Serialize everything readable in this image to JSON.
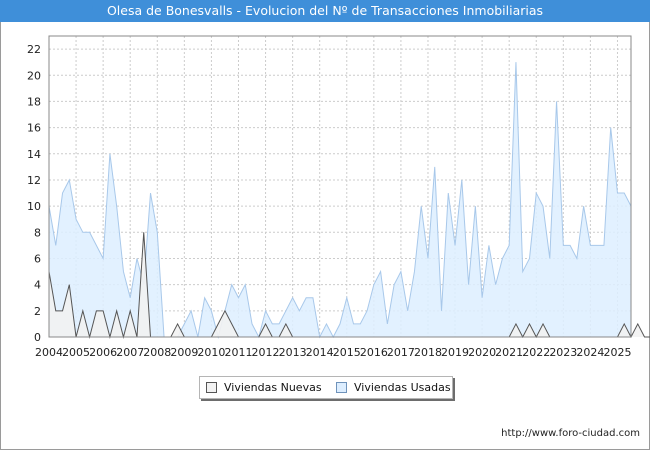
{
  "title": "Olesa de Bonesvalls - Evolucion del Nº de Transacciones Inmobiliarias",
  "footer_url": "http://www.foro-ciudad.com",
  "colors": {
    "title_bg": "#3f8fd9",
    "nuevas_fill": "#f2f2f2",
    "nuevas_line": "#555555",
    "usadas_fill": "#ddeeff",
    "usadas_line": "#a8c8ea",
    "grid": "#cccccc"
  },
  "chart_data": {
    "type": "area",
    "title": "Olesa de Bonesvalls - Evolucion del Nº de Transacciones Inmobiliarias",
    "xlabel": "",
    "ylabel": "",
    "x_ticks": [
      "2004",
      "2005",
      "2006",
      "2007",
      "2008",
      "2009",
      "2010",
      "2011",
      "2012",
      "2013",
      "2014",
      "2015",
      "2016",
      "2017",
      "2018",
      "2019",
      "2020",
      "2021",
      "2022",
      "2023",
      "2024",
      "2025"
    ],
    "x_range": [
      "2004 Q1",
      "2025 Q1"
    ],
    "y_ticks": [
      0,
      2,
      4,
      6,
      8,
      10,
      12,
      14,
      16,
      18,
      20,
      22
    ],
    "ylim": [
      0,
      23
    ],
    "grid": true,
    "legend_position": "bottom-center",
    "periods": "quarterly, 2004 Q1 to 2025 Q1",
    "series": [
      {
        "name": "Viviendas Nuevas",
        "values": [
          5,
          2,
          2,
          4,
          0,
          2,
          0,
          2,
          2,
          0,
          2,
          0,
          2,
          0,
          8,
          0,
          0,
          0,
          0,
          1,
          0,
          0,
          0,
          0,
          0,
          1,
          2,
          1,
          0,
          0,
          0,
          0,
          1,
          0,
          0,
          1,
          0,
          0,
          0,
          0,
          0,
          0,
          0,
          0,
          0,
          0,
          0,
          0,
          0,
          0,
          0,
          0,
          0,
          0,
          0,
          0,
          0,
          0,
          0,
          0,
          0,
          0,
          0,
          0,
          0,
          0,
          0,
          0,
          0,
          1,
          0,
          1,
          0,
          1,
          0,
          0,
          0,
          0,
          0,
          0,
          0,
          0,
          0,
          0,
          0,
          1,
          0,
          1,
          0,
          0,
          0,
          0,
          0,
          0,
          0,
          0,
          0,
          0,
          0,
          0,
          0,
          0,
          0,
          0,
          0
        ]
      },
      {
        "name": "Viviendas Usadas",
        "values": [
          10,
          7,
          11,
          12,
          9,
          8,
          8,
          7,
          6,
          14,
          10,
          5,
          3,
          6,
          4,
          11,
          8,
          0,
          0,
          0,
          1,
          2,
          0,
          3,
          2,
          0,
          2,
          4,
          3,
          4,
          1,
          0,
          2,
          1,
          1,
          2,
          3,
          2,
          3,
          3,
          0,
          1,
          0,
          1,
          3,
          1,
          1,
          2,
          4,
          5,
          1,
          4,
          5,
          2,
          5,
          10,
          6,
          13,
          2,
          11,
          7,
          12,
          4,
          10,
          3,
          7,
          4,
          6,
          7,
          21,
          5,
          6,
          11,
          10,
          6,
          18,
          7,
          7,
          6,
          10,
          7,
          7,
          7,
          16,
          11,
          11,
          10
        ]
      }
    ]
  },
  "legend": {
    "items": [
      {
        "label": "Viviendas Nuevas"
      },
      {
        "label": "Viviendas Usadas"
      }
    ]
  }
}
